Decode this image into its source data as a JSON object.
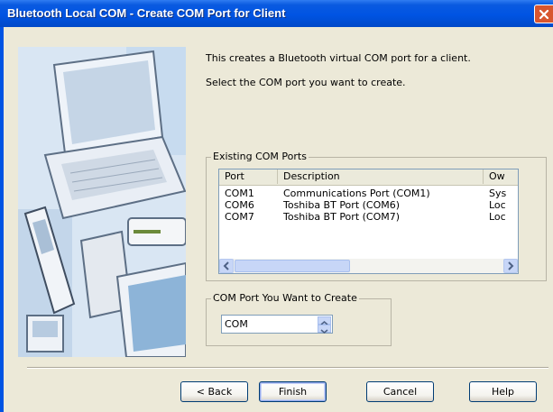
{
  "window": {
    "title": "Bluetooth Local COM - Create COM Port for Client"
  },
  "intro": {
    "line1": "This creates a Bluetooth virtual COM port for a client.",
    "line2": "Select the COM port you want to create."
  },
  "existing_ports": {
    "group_label": "Existing COM Ports",
    "columns": [
      "Port",
      "Description",
      "Owner"
    ],
    "column_labels_visible": [
      "Port",
      "Description",
      "Ow"
    ],
    "rows": [
      {
        "port": "COM1",
        "description": "Communications Port (COM1)",
        "owner": "Sys"
      },
      {
        "port": "COM6",
        "description": "Toshiba BT Port (COM6)",
        "owner": "Loc"
      },
      {
        "port": "COM7",
        "description": "Toshiba BT Port (COM7)",
        "owner": "Loc"
      }
    ]
  },
  "create_port": {
    "group_label": "COM Port You Want to Create",
    "value": "COM"
  },
  "buttons": {
    "back": "< Back",
    "finish": "Finish",
    "cancel": "Cancel",
    "help": "Help"
  },
  "colors": {
    "titlebar": "#0054e3",
    "dialog_bg": "#ece9d8",
    "close_button": "#d8562f"
  },
  "icons": [
    "close-icon",
    "scroll-left-icon",
    "scroll-right-icon",
    "spin-up-icon",
    "spin-down-icon"
  ]
}
